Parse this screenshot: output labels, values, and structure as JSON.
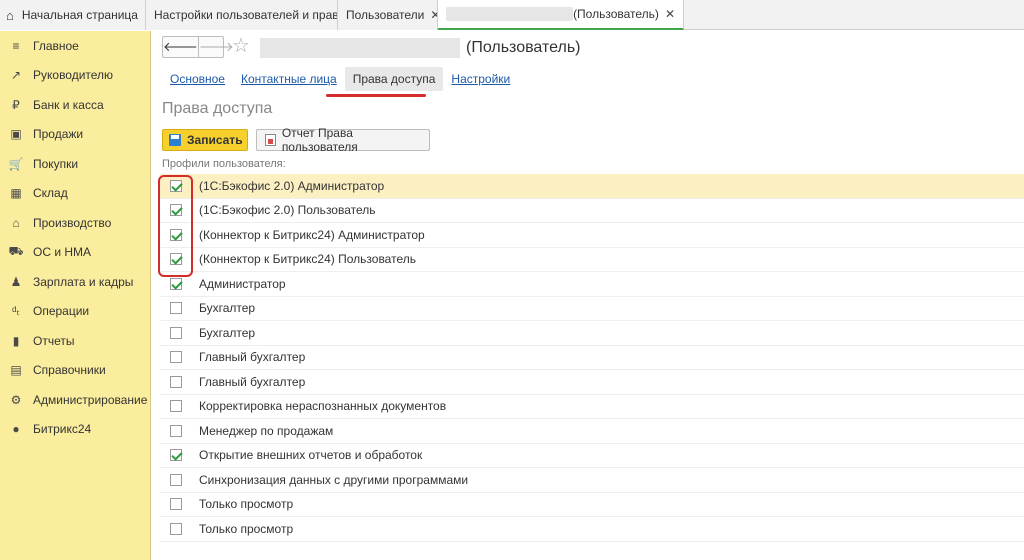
{
  "tabs": {
    "home": "Начальная страница",
    "settings": "Настройки пользователей и прав",
    "users": "Пользователи",
    "current": "(Пользователь)",
    "close_glyph": "✕"
  },
  "sidebar": {
    "items": [
      {
        "label": "Главное",
        "icon": "≡"
      },
      {
        "label": "Руководителю",
        "icon": "↗"
      },
      {
        "label": "Банк и касса",
        "icon": "₽"
      },
      {
        "label": "Продажи",
        "icon": "▣"
      },
      {
        "label": "Покупки",
        "icon": "🛒"
      },
      {
        "label": "Склад",
        "icon": "▦"
      },
      {
        "label": "Производство",
        "icon": "⌂"
      },
      {
        "label": "ОС и НМА",
        "icon": "⛟"
      },
      {
        "label": "Зарплата и кадры",
        "icon": "♟"
      },
      {
        "label": "Операции",
        "icon": "ᵈₜ"
      },
      {
        "label": "Отчеты",
        "icon": "▮"
      },
      {
        "label": "Справочники",
        "icon": "▤"
      },
      {
        "label": "Администрирование",
        "icon": "⚙"
      },
      {
        "label": "Битрикс24",
        "icon": "●"
      }
    ]
  },
  "header": {
    "back": "🡐",
    "forward": "🡒",
    "star": "☆",
    "title": "(Пользователь)"
  },
  "subtabs": [
    "Основное",
    "Контактные лица",
    "Права доступа",
    "Настройки"
  ],
  "section_title": "Права доступа",
  "toolbar": {
    "save_label": "Записать",
    "report_label": "Отчет Права пользователя"
  },
  "profiles_label": "Профили пользователя:",
  "profiles": [
    {
      "label": "(1С:Бэкофис 2.0) Администратор",
      "checked": true
    },
    {
      "label": "(1С:Бэкофис 2.0) Пользователь",
      "checked": true
    },
    {
      "label": "(Коннектор к Битрикс24) Администратор",
      "checked": true
    },
    {
      "label": "(Коннектор к Битрикс24) Пользователь",
      "checked": true
    },
    {
      "label": "Администратор",
      "checked": true
    },
    {
      "label": "Бухгалтер",
      "checked": false
    },
    {
      "label": "Бухгалтер",
      "checked": false
    },
    {
      "label": "Главный бухгалтер",
      "checked": false
    },
    {
      "label": "Главный бухгалтер",
      "checked": false
    },
    {
      "label": "Корректировка нераспознанных документов",
      "checked": false
    },
    {
      "label": "Менеджер по продажам",
      "checked": false
    },
    {
      "label": "Открытие внешних отчетов и обработок",
      "checked": true
    },
    {
      "label": "Синхронизация данных с другими программами",
      "checked": false
    },
    {
      "label": "Только просмотр",
      "checked": false
    },
    {
      "label": "Только просмотр",
      "checked": false
    }
  ],
  "colors": {
    "sidebar_bg": "#fbed9e",
    "accent_green": "#3fa64a",
    "save_yellow": "#f7d02e",
    "highlight_red": "#d62b2b",
    "link_blue": "#1c5aa9"
  }
}
